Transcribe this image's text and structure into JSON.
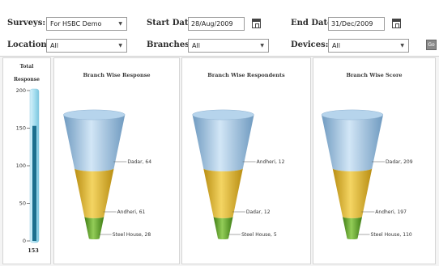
{
  "filters": {
    "surveys": {
      "label": "Surveys:",
      "value": "For HSBC Demo"
    },
    "start_date": {
      "label": "Start Date:",
      "value": "28/Aug/2009"
    },
    "end_date": {
      "label": "End Date:",
      "value": "31/Dec/2009"
    },
    "location": {
      "label": "Location:",
      "value": "All"
    },
    "branches": {
      "label": "Branches:",
      "value": "All"
    },
    "devices": {
      "label": "Devices:",
      "value": "All"
    },
    "go_label": "Go"
  },
  "gauge": {
    "title_line1": "Total",
    "title_line2": "Response",
    "value": 153,
    "value_label": "153",
    "max": 200,
    "ticks": [
      "200",
      "150",
      "100",
      "50",
      "0"
    ],
    "colors": {
      "fill": "#1c6f8e",
      "tube": "#a9dff0"
    }
  },
  "chart_data": [
    {
      "type": "funnel",
      "title": "Branch Wise Response",
      "series": [
        {
          "name": "Dadar",
          "value": 64,
          "label": "Dadar, 64"
        },
        {
          "name": "Andheri",
          "value": 61,
          "label": "Andheri, 61"
        },
        {
          "name": "Steel House",
          "value": 28,
          "label": "Steel House, 28"
        }
      ]
    },
    {
      "type": "funnel",
      "title": "Branch Wise Respondents",
      "series": [
        {
          "name": "Andheri",
          "value": 12,
          "label": "Andheri, 12"
        },
        {
          "name": "Dadar",
          "value": 12,
          "label": "Dadar, 12"
        },
        {
          "name": "Steel House",
          "value": 5,
          "label": "Steel House, 5"
        }
      ]
    },
    {
      "type": "funnel",
      "title": "Branch Wise Score",
      "series": [
        {
          "name": "Dadar",
          "value": 209,
          "label": "Dadar, 209"
        },
        {
          "name": "Andheri",
          "value": 197,
          "label": "Andheri, 197"
        },
        {
          "name": "Steel House",
          "value": 110,
          "label": "Steel House, 110"
        }
      ]
    }
  ],
  "colors": {
    "top": "#9ec4e4",
    "middle": "#e3b628",
    "bottom": "#63a826"
  }
}
